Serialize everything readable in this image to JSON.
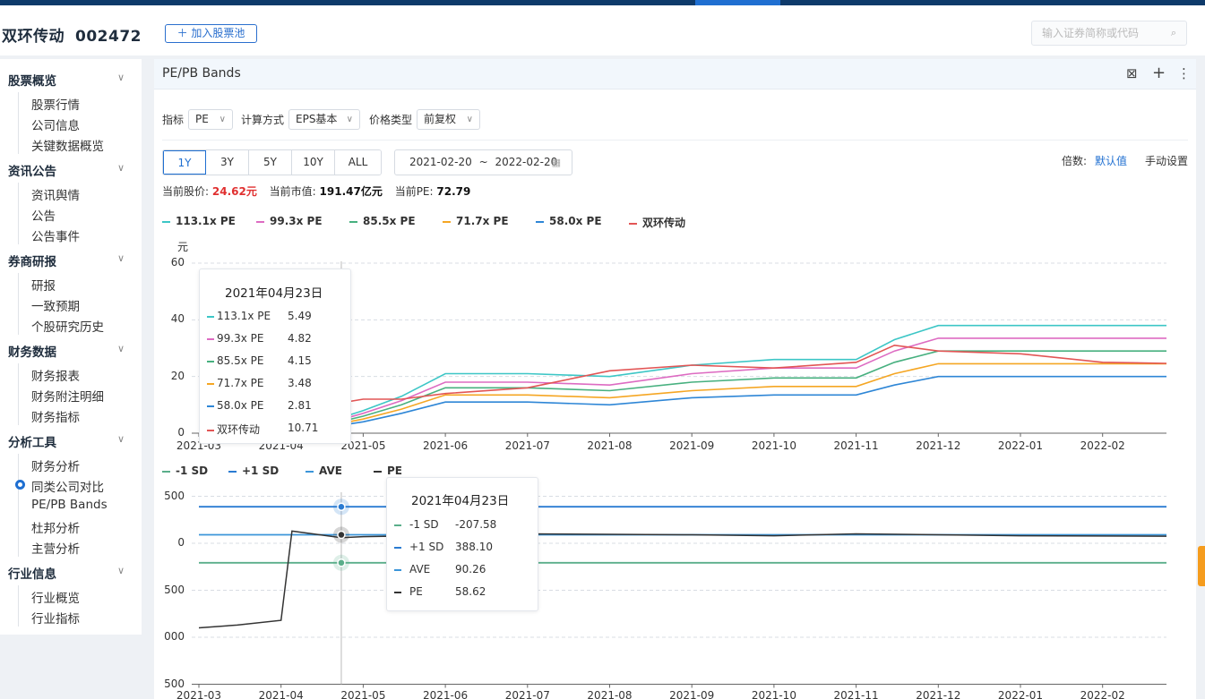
{
  "header": {
    "stock_name": "双环传动",
    "stock_code": "002472",
    "add_pool_label": "＋ 加入股票池",
    "search_placeholder": "输入证券简称或代码"
  },
  "sidebar": {
    "sections": [
      {
        "title": "股票概览",
        "items": [
          "股票行情",
          "公司信息",
          "关键数据概览"
        ]
      },
      {
        "title": "资讯公告",
        "items": [
          "资讯舆情",
          "公告",
          "公告事件"
        ]
      },
      {
        "title": "券商研报",
        "items": [
          "研报",
          "一致预期",
          "个股研究历史"
        ]
      },
      {
        "title": "财务数据",
        "items": [
          "财务报表",
          "财务附注明细",
          "财务指标"
        ]
      },
      {
        "title": "分析工具",
        "items": [
          "财务分析",
          "同类公司对比",
          "PE/PB Bands",
          "杜邦分析",
          "主营分析"
        ]
      },
      {
        "title": "行业信息",
        "items": [
          "行业概览",
          "行业指标"
        ]
      }
    ],
    "active_item": "同类公司对比"
  },
  "panel": {
    "title": "PE/PB Bands",
    "filters": {
      "indicator_label": "指标",
      "indicator_value": "PE",
      "method_label": "计算方式",
      "method_value": "EPS基本",
      "price_label": "价格类型",
      "price_value": "前复权"
    },
    "ranges": [
      "1Y",
      "3Y",
      "5Y",
      "10Y",
      "ALL"
    ],
    "active_range": "1Y",
    "date_from": "2021-02-20",
    "date_sep": "~",
    "date_to": "2022-02-20",
    "multiple_label": "倍数:",
    "multiple_default": "默认值",
    "multiple_manual": "手动设置",
    "metrics": {
      "price_label": "当前股价:",
      "price_value": "24.62元",
      "mcap_label": "当前市值:",
      "mcap_value": "191.47亿元",
      "pe_label": "当前PE:",
      "pe_value": "72.79"
    }
  },
  "colors": {
    "teal": "#3cc6c6",
    "pink": "#dd6bc2",
    "green": "#47b07f",
    "orange": "#f5a623",
    "blue": "#2e86d6",
    "red": "#e25555",
    "dark": "#333333",
    "sd_green": "#5aae8a",
    "sd_blue": "#2a7bd2",
    "ave_blue": "#3b95d9"
  },
  "chart_data": [
    {
      "type": "line",
      "ylabel": "元",
      "y_ticks": [
        "60",
        "40",
        "20",
        "0"
      ],
      "x_ticks": [
        "2021-03",
        "2021-04",
        "2021-05",
        "2021-06",
        "2021-07",
        "2021-08",
        "2021-09",
        "2021-10",
        "2021-11",
        "2021-12",
        "2022-01",
        "2022-02"
      ],
      "ylim": [
        0,
        60
      ],
      "grid": true,
      "legend_position": "top-left",
      "x": [
        "2021-03",
        "2021-04",
        "2021-04-23",
        "2021-05",
        "2021-05-15",
        "2021-06",
        "2021-07",
        "2021-08",
        "2021-09",
        "2021-10",
        "2021-11",
        "2021-11-15",
        "2021-12",
        "2022-01",
        "2022-02",
        "2022-02-20"
      ],
      "series": [
        {
          "name": "113.1x PE",
          "color": "teal",
          "values": [
            null,
            null,
            5.49,
            8,
            13,
            21,
            21,
            20,
            24,
            26,
            26,
            33,
            38,
            38,
            38,
            38
          ]
        },
        {
          "name": "99.3x PE",
          "color": "pink",
          "values": [
            null,
            null,
            4.82,
            7,
            11.5,
            18,
            18,
            17,
            21,
            23,
            23,
            29,
            33.5,
            33.5,
            33.5,
            33.5
          ]
        },
        {
          "name": "85.5x PE",
          "color": "green",
          "values": [
            null,
            null,
            4.15,
            6,
            10,
            16,
            16,
            15,
            18,
            19.5,
            19.5,
            25,
            29,
            29,
            29,
            29
          ]
        },
        {
          "name": "71.7x PE",
          "color": "orange",
          "values": [
            null,
            null,
            3.48,
            5,
            8.5,
            13.5,
            13.5,
            12.5,
            15,
            16.5,
            16.5,
            21,
            24.5,
            24.5,
            24.5,
            24.5
          ]
        },
        {
          "name": "58.0x PE",
          "color": "blue",
          "values": [
            null,
            null,
            2.81,
            4,
            7,
            11,
            11,
            10,
            12.5,
            13.5,
            13.5,
            17,
            20,
            20,
            20,
            20
          ]
        },
        {
          "name": "双环传动",
          "color": "red",
          "values": [
            9,
            10,
            10.71,
            12,
            12,
            14,
            16,
            22,
            24,
            23,
            25,
            31,
            29,
            28,
            25,
            24.62
          ]
        }
      ],
      "tooltip": {
        "date": "2021年04月23日",
        "rows": [
          {
            "name": "113.1x PE",
            "value": "5.49"
          },
          {
            "name": "99.3x PE",
            "value": "4.82"
          },
          {
            "name": "85.5x PE",
            "value": "4.15"
          },
          {
            "name": "71.7x PE",
            "value": "3.48"
          },
          {
            "name": "58.0x PE",
            "value": "2.81"
          },
          {
            "name": "双环传动",
            "value": "10.71"
          }
        ]
      }
    },
    {
      "type": "line",
      "y_ticks": [
        "500",
        "0",
        "500",
        "000",
        "500"
      ],
      "x_ticks": [
        "2021-03",
        "2021-04",
        "2021-05",
        "2021-06",
        "2021-07",
        "2021-08",
        "2021-09",
        "2021-10",
        "2021-11",
        "2021-12",
        "2022-01",
        "2022-02"
      ],
      "ylim": [
        -1500,
        500
      ],
      "grid": true,
      "legend_position": "top-left",
      "x": [
        "2021-03",
        "2021-03-15",
        "2021-04",
        "2021-04-05",
        "2021-04-23",
        "2021-05",
        "2021-06",
        "2021-07",
        "2021-08",
        "2021-09",
        "2021-10",
        "2021-11",
        "2021-12",
        "2022-01",
        "2022-02"
      ],
      "series": [
        {
          "name": "-1 SD",
          "color": "sd_green",
          "values": [
            -207.58,
            -207.58,
            -207.58,
            -207.58,
            -207.58,
            -207.58,
            -207.58,
            -207.58,
            -207.58,
            -207.58,
            -207.58,
            -207.58,
            -207.58,
            -207.58,
            -207.58
          ]
        },
        {
          "name": "+1 SD",
          "color": "sd_blue",
          "values": [
            388.1,
            388.1,
            388.1,
            388.1,
            388.1,
            388.1,
            388.1,
            388.1,
            388.1,
            388.1,
            388.1,
            388.1,
            388.1,
            388.1,
            388.1
          ]
        },
        {
          "name": "AVE",
          "color": "ave_blue",
          "values": [
            90.26,
            90.26,
            90.26,
            90.26,
            90.26,
            90.26,
            90.26,
            90.26,
            90.26,
            90.26,
            90.26,
            90.26,
            90.26,
            90.26,
            90.26
          ]
        },
        {
          "name": "PE",
          "color": "dark",
          "values": [
            -900,
            -870,
            -820,
            130,
            58.62,
            70,
            85,
            100,
            95,
            90,
            80,
            100,
            90,
            80,
            75
          ]
        }
      ],
      "tooltip": {
        "date": "2021年04月23日",
        "rows": [
          {
            "name": "-1 SD",
            "value": "-207.58"
          },
          {
            "name": "+1 SD",
            "value": "388.10"
          },
          {
            "name": "AVE",
            "value": "90.26"
          },
          {
            "name": "PE",
            "value": "58.62"
          }
        ]
      }
    }
  ]
}
